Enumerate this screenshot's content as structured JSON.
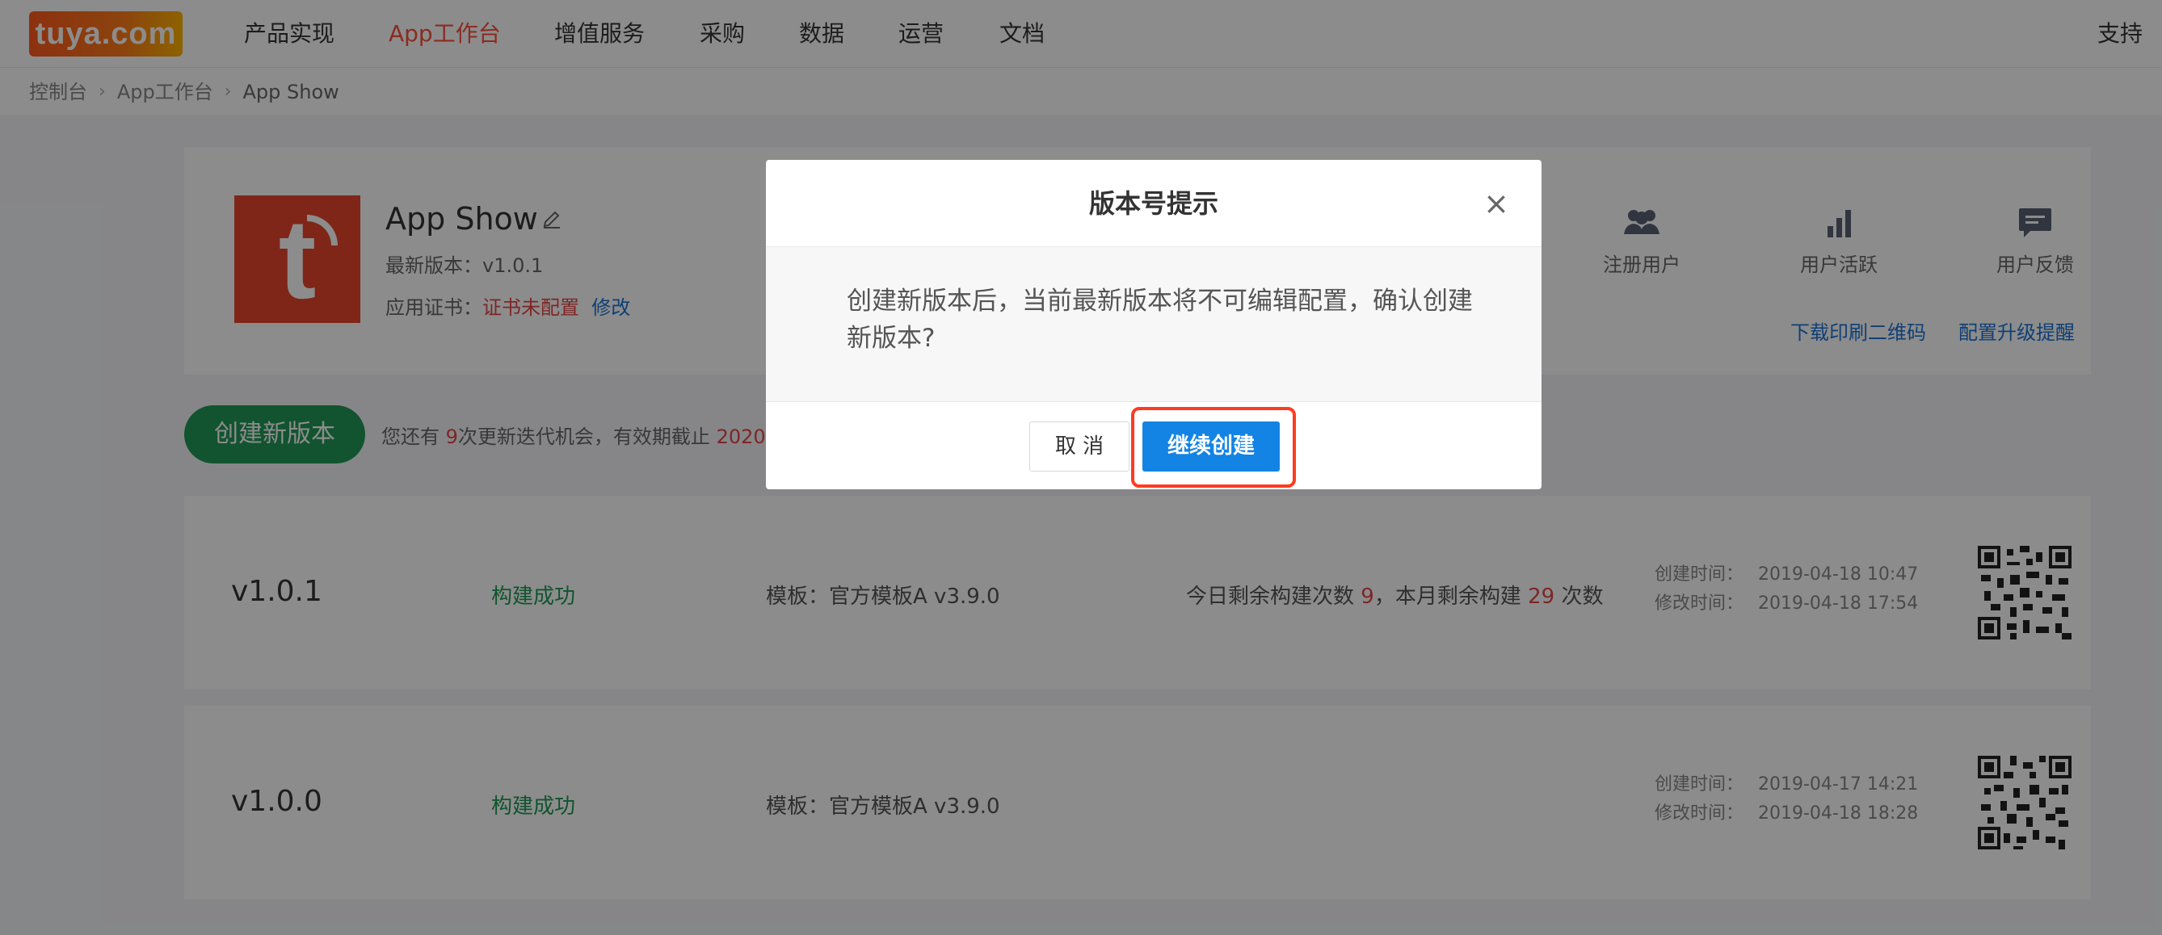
{
  "nav": {
    "logo": "tuya.com",
    "items": [
      {
        "label": "产品实现",
        "active": false
      },
      {
        "label": "App工作台",
        "active": true
      },
      {
        "label": "增值服务",
        "active": false
      },
      {
        "label": "采购",
        "active": false
      },
      {
        "label": "数据",
        "active": false
      },
      {
        "label": "运营",
        "active": false
      },
      {
        "label": "文档",
        "active": false
      }
    ],
    "support": "支持"
  },
  "breadcrumb": [
    "控制台",
    "App工作台",
    "App Show"
  ],
  "app": {
    "name": "App Show",
    "latest_version_label": "最新版本：",
    "latest_version": "v1.0.1",
    "cert_label": "应用证书：",
    "cert_status": "证书未配置",
    "cert_edit": "修改",
    "stats": [
      {
        "label": "注册用户",
        "icon": "users-icon"
      },
      {
        "label": "用户活跃",
        "icon": "bar-chart-icon"
      },
      {
        "label": "用户反馈",
        "icon": "chat-icon"
      }
    ],
    "links": [
      "下载印刷二维码",
      "配置升级提醒"
    ]
  },
  "create": {
    "button": "创建新版本",
    "tip_prefix": "您还有",
    "tip_count": "9",
    "tip_mid": "次更新迭代机会，有效期截止",
    "tip_date": "2020-"
  },
  "versions": [
    {
      "version": "v1.0.1",
      "status": "构建成功",
      "template": "模板：官方模板A v3.9.0",
      "quota_a": "今日剩余构建次数",
      "quota_today": "9",
      "quota_b": "，本月剩余构建",
      "quota_month": "29",
      "quota_c": "次数",
      "created_label": "创建时间：",
      "created": "2019-04-18 10:47",
      "modified_label": "修改时间：",
      "modified": "2019-04-18 17:54"
    },
    {
      "version": "v1.0.0",
      "status": "构建成功",
      "template": "模板：官方模板A v3.9.0",
      "created_label": "创建时间：",
      "created": "2019-04-17 14:21",
      "modified_label": "修改时间：",
      "modified": "2019-04-18 18:28"
    }
  ],
  "modal": {
    "title": "版本号提示",
    "message": "创建新版本后，当前最新版本将不可编辑配置，确认创建新版本?",
    "cancel": "取 消",
    "confirm": "继续创建"
  },
  "colors": {
    "accent_blue": "#1383e4",
    "brand_green": "#1f9a57",
    "alert_red": "#e64545",
    "highlight_red": "#ff3b1f"
  }
}
